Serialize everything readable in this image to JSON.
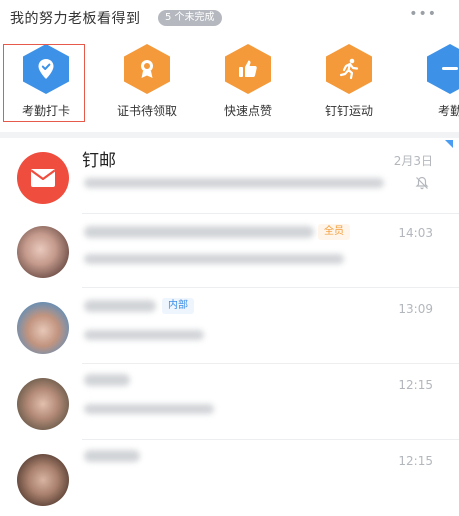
{
  "header": {
    "title": "我的努力老板看得到",
    "badge": "5 个未完成",
    "more_icon": "more-dots-icon"
  },
  "shortcuts": [
    {
      "label": "考勤打卡",
      "icon": "location-check-icon",
      "color": "#3d92e8",
      "selected": true
    },
    {
      "label": "证书待领取",
      "icon": "certificate-icon",
      "color": "#f49a3a",
      "selected": false
    },
    {
      "label": "快速点赞",
      "icon": "thumbs-up-icon",
      "color": "#f49a3a",
      "selected": false
    },
    {
      "label": "钉钉运动",
      "icon": "running-icon",
      "color": "#f49a3a",
      "selected": false
    },
    {
      "label": "考勤",
      "icon": "partial-icon",
      "color": "#3d92e8",
      "selected": false
    }
  ],
  "messages": [
    {
      "name": "钉邮",
      "time": "2月3日",
      "avatar_color": "#ef4d3e",
      "muted": true
    },
    {
      "name": "",
      "time": "14:03",
      "tag": "全员"
    },
    {
      "name": "",
      "time": "13:09",
      "tag": "内部"
    },
    {
      "name": "",
      "time": "12:15"
    },
    {
      "name": "",
      "time": "12:15"
    }
  ],
  "colors": {
    "accent_blue": "#3d92e8",
    "accent_orange": "#f49a3a",
    "mail_red": "#ef4d3e",
    "highlight_red": "#e65a4c",
    "time_gray": "#b3b7bc"
  }
}
